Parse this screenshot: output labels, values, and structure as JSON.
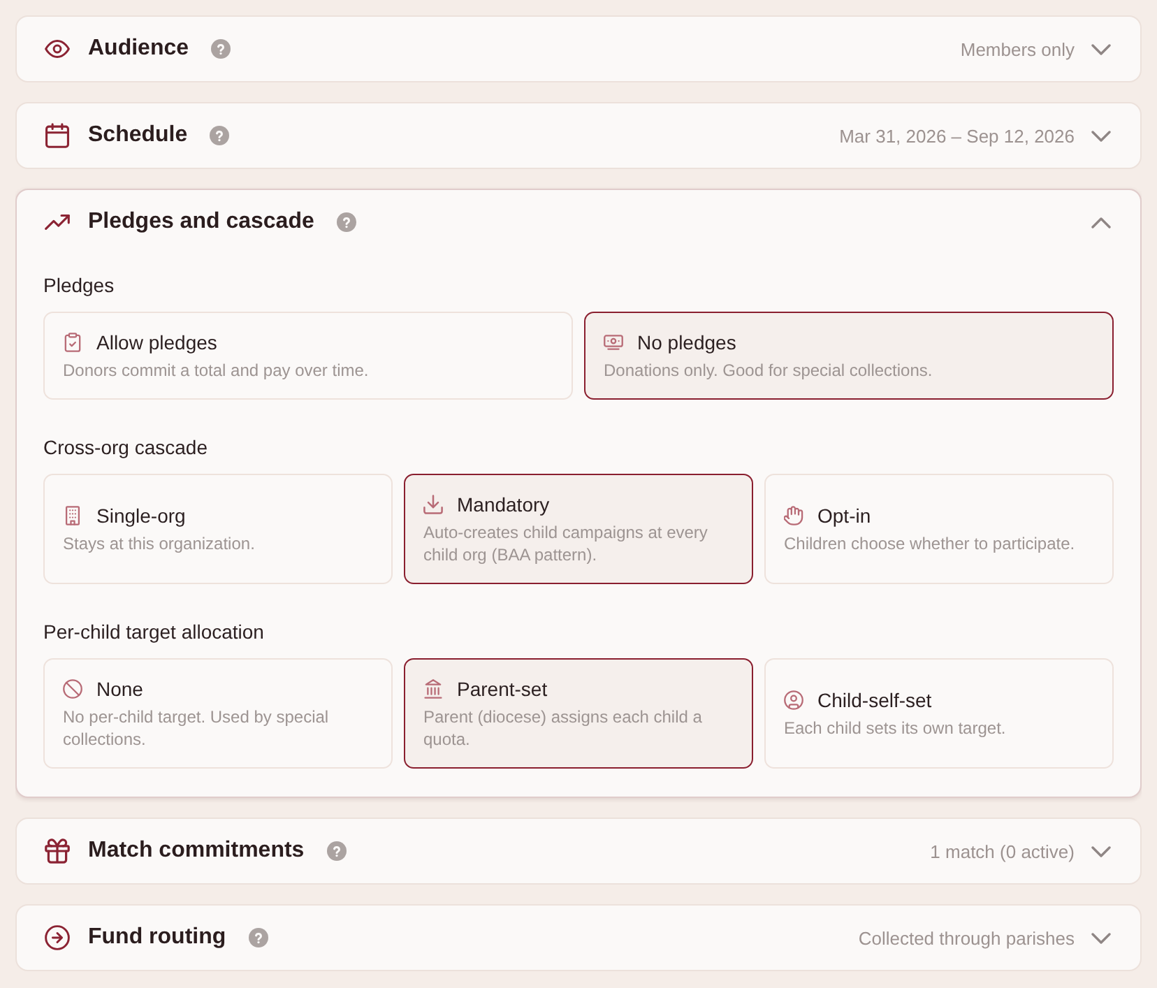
{
  "sections": [
    {
      "title": "Audience",
      "summary": "Members only",
      "expanded": false
    },
    {
      "title": "Schedule",
      "summary": "Mar 31, 2026 – Sep 12, 2026",
      "expanded": false
    },
    {
      "title": "Pledges and cascade",
      "expanded": true,
      "groups": [
        {
          "label": "Pledges",
          "options": [
            {
              "title": "Allow pledges",
              "description": "Donors commit a total and pay over time.",
              "selected": false
            },
            {
              "title": "No pledges",
              "description": "Donations only. Good for special collections.",
              "selected": true
            }
          ]
        },
        {
          "label": "Cross-org cascade",
          "options": [
            {
              "title": "Single-org",
              "description": "Stays at this organization.",
              "selected": false
            },
            {
              "title": "Mandatory",
              "description": "Auto-creates child campaigns at every child org (BAA pattern).",
              "selected": true
            },
            {
              "title": "Opt-in",
              "description": "Children choose whether to participate.",
              "selected": false
            }
          ]
        },
        {
          "label": "Per-child target allocation",
          "options": [
            {
              "title": "None",
              "description": "No per-child target. Used by special collections.",
              "selected": false
            },
            {
              "title": "Parent-set",
              "description": "Parent (diocese) assigns each child a quota.",
              "selected": true
            },
            {
              "title": "Child-self-set",
              "description": "Each child sets its own target.",
              "selected": false
            }
          ]
        }
      ]
    },
    {
      "title": "Match commitments",
      "summary": "1 match (0 active)",
      "expanded": false
    },
    {
      "title": "Fund routing",
      "summary": "Collected through parishes",
      "expanded": false
    }
  ]
}
